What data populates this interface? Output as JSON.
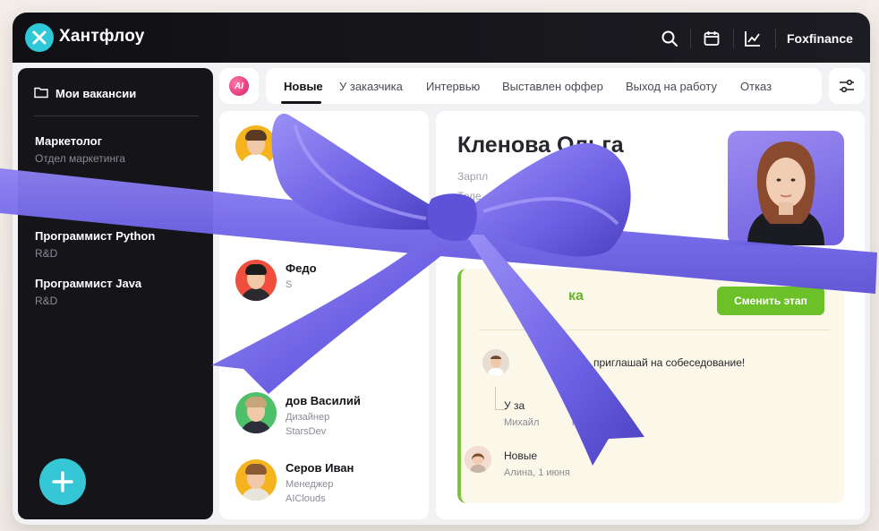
{
  "app": {
    "brand": "Хантфлоу",
    "account": "Foxfinance"
  },
  "icons": {
    "search": "search-icon",
    "calendar": "calendar-icon",
    "analytics": "chart-icon",
    "folder": "folder-icon",
    "add": "plus-icon",
    "filter": "filter-icon"
  },
  "colors": {
    "accent": "#36c7d6",
    "stage_green": "#6cc028",
    "ribbon": "#6f63e6",
    "topbar": "#141419"
  },
  "sidebar": {
    "header": "Мои вакансии",
    "vacancies": [
      {
        "title": "Маркетолог",
        "dept": "Отдел маркетинга"
      },
      {
        "title": "Программист Python",
        "dept": "R&D"
      },
      {
        "title": "Программист Java",
        "dept": "R&D"
      }
    ]
  },
  "ai_label": "AI",
  "tabs": [
    "Новые",
    "У заказчика",
    "Интервью",
    "Выставлен оффер",
    "Выход на работу",
    "Отказ"
  ],
  "candidates": [
    {
      "name": "Пла",
      "role": "",
      "company": "Ja"
    },
    {
      "name": "Федо",
      "role": "S",
      "company": ""
    },
    {
      "name": "",
      "role": "",
      "company": "ce"
    },
    {
      "name": "дов Василий",
      "role": "Дизайнер",
      "company": "StarsDev"
    },
    {
      "name": "Серов Иван",
      "role": "Менеджер",
      "company": "AIClouds"
    }
  ],
  "detail": {
    "name": "Кленова Ольга",
    "salary_label": "Зарпл",
    "phone_label": "Теле",
    "stage_label": "ка",
    "change_stage": "Сменить этап",
    "events": [
      {
        "text": "приглашай на собеседование!"
      },
      {
        "text": "У за",
        "sub": "Михайл",
        "sub_tail": "ня"
      },
      {
        "text": "Новые",
        "sub": "Алина, 1 июня"
      }
    ]
  }
}
